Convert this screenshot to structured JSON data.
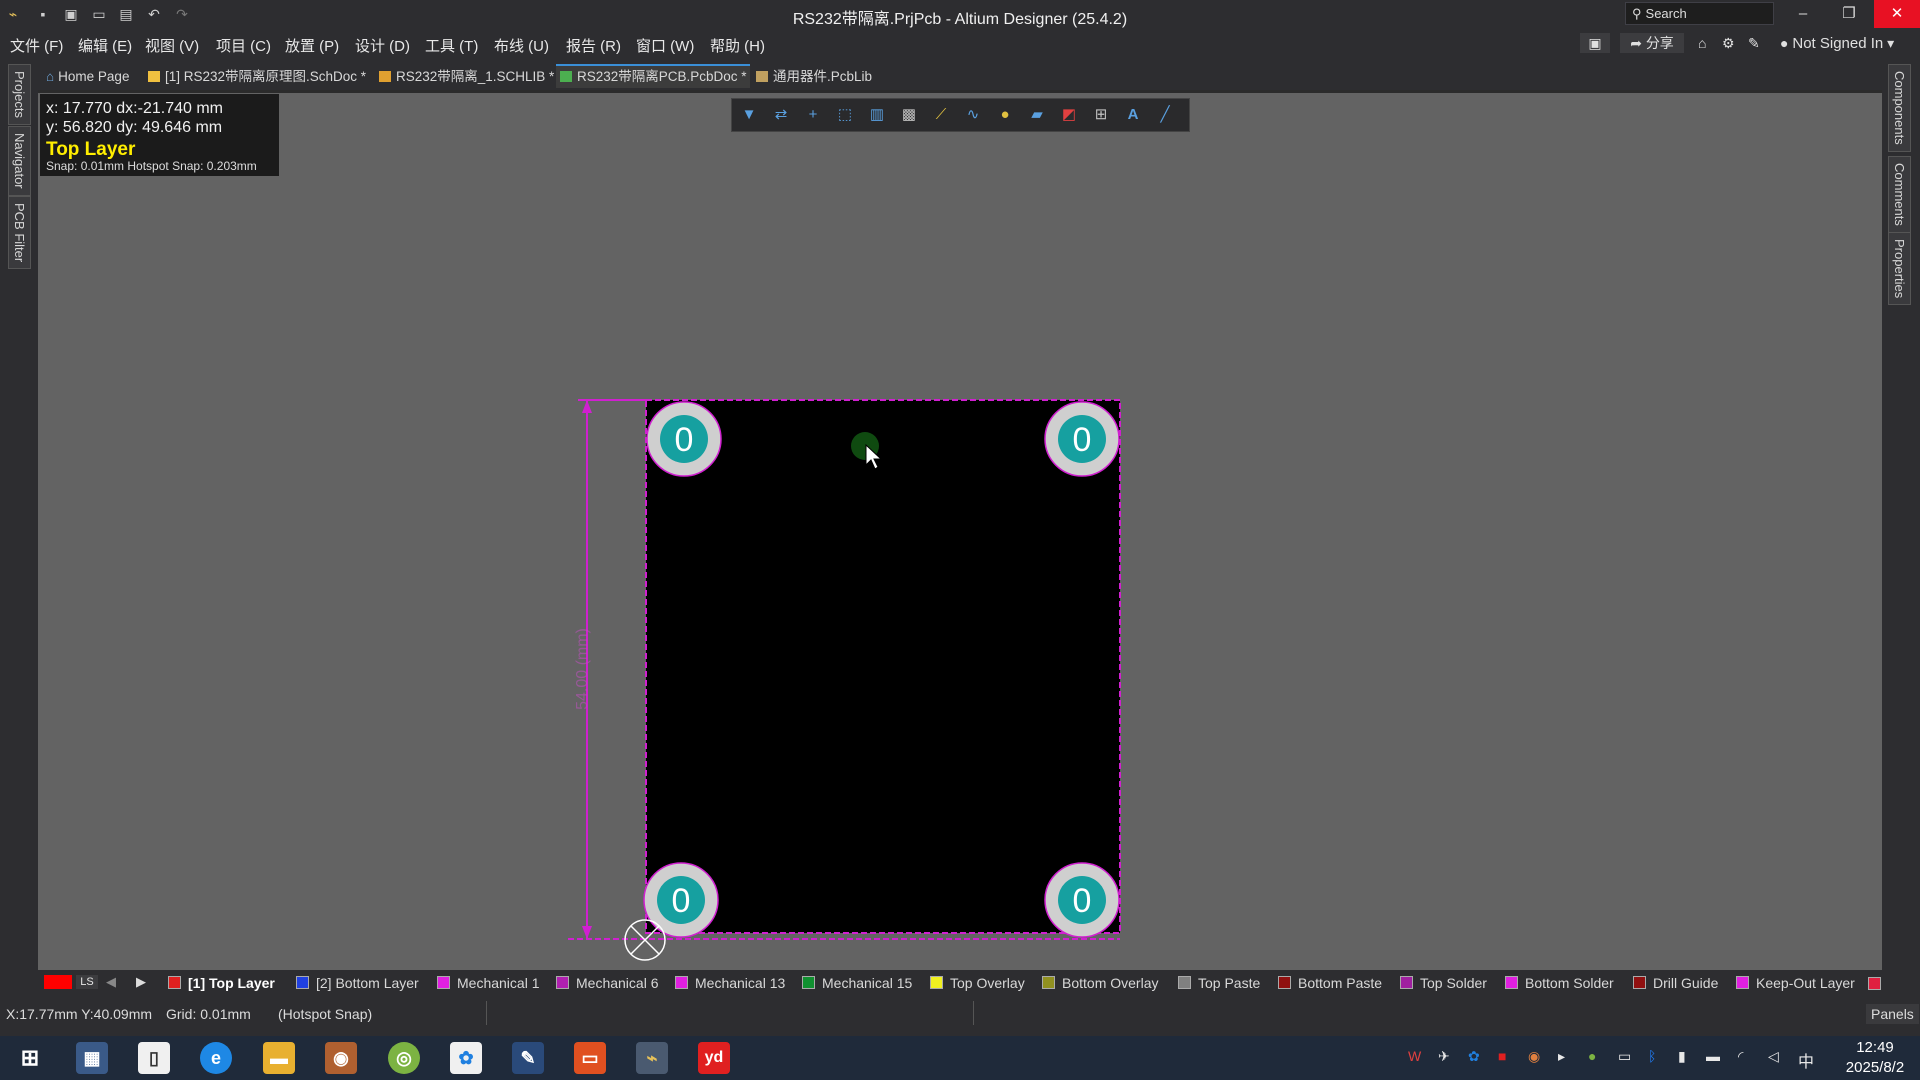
{
  "window": {
    "title": "RS232带隔离.PrjPcb - Altium Designer (25.4.2)",
    "search_label": "Search",
    "minimize": "–",
    "restore": "❐",
    "close": "✕"
  },
  "menu": [
    "文件 (F)",
    "编辑 (E)",
    "视图 (V)",
    "项目 (C)",
    "放置 (P)",
    "设计 (D)",
    "工具 (T)",
    "布线 (U)",
    "报告 (R)",
    "窗口 (W)",
    "帮助 (H)"
  ],
  "menu_right": {
    "share_label": "分享",
    "account_label": "Not Signed In"
  },
  "tabs": [
    {
      "label": "Home Page",
      "color": "#6fa8dc"
    },
    {
      "label": "[1] RS232带隔离原理图.SchDoc *",
      "color": "#f0c040"
    },
    {
      "label": "RS232带隔离_1.SCHLIB *",
      "color": "#e0a030"
    },
    {
      "label": "RS232带隔离PCB.PcbDoc *",
      "color": "#4caf50"
    },
    {
      "label": "通用器件.PcbLib",
      "color": "#c0a060"
    }
  ],
  "left_panels": [
    "Projects",
    "Navigator",
    "PCB Filter"
  ],
  "right_panels": [
    "Components",
    "Comments",
    "Properties"
  ],
  "hud": {
    "coords_x": "x: 17.770   dx:-21.740 mm",
    "coords_y": "y: 56.820   dy: 49.646 mm",
    "layer": "Top Layer",
    "snap": "Snap: 0.01mm Hotspot Snap: 0.203mm"
  },
  "board": {
    "pad_label": "0",
    "dimension_label": "54.00 (mm)",
    "outline_color": "#d020d0",
    "board_color": "#000000",
    "pad_color": "#cfcfcf",
    "pad_hole_color": "#16a0a0"
  },
  "layers": [
    {
      "label": "[1] Top Layer",
      "color": "#e02020",
      "active": true
    },
    {
      "label": "[2] Bottom Layer",
      "color": "#2040e0"
    },
    {
      "label": "Mechanical 1",
      "color": "#e020e0"
    },
    {
      "label": "Mechanical 6",
      "color": "#b020b0"
    },
    {
      "label": "Mechanical 13",
      "color": "#e020e0"
    },
    {
      "label": "Mechanical 15",
      "color": "#109030"
    },
    {
      "label": "Top Overlay",
      "color": "#f0f020"
    },
    {
      "label": "Bottom Overlay",
      "color": "#909020"
    },
    {
      "label": "Top Paste",
      "color": "#808080"
    },
    {
      "label": "Bottom Paste",
      "color": "#901010"
    },
    {
      "label": "Top Solder",
      "color": "#a020a0"
    },
    {
      "label": "Bottom Solder",
      "color": "#e020e0"
    },
    {
      "label": "Drill Guide",
      "color": "#901010"
    },
    {
      "label": "Keep-Out Layer",
      "color": "#e020e0"
    }
  ],
  "layer_controls": {
    "ls": "LS",
    "current_color": "#ff0000"
  },
  "status": {
    "position": "X:17.77mm Y:40.09mm",
    "grid": "Grid: 0.01mm",
    "snap": "(Hotspot Snap)",
    "panels": "Panels"
  },
  "taskbar": {
    "time": "12:49",
    "date": "2025/8/2",
    "ime": "中"
  }
}
